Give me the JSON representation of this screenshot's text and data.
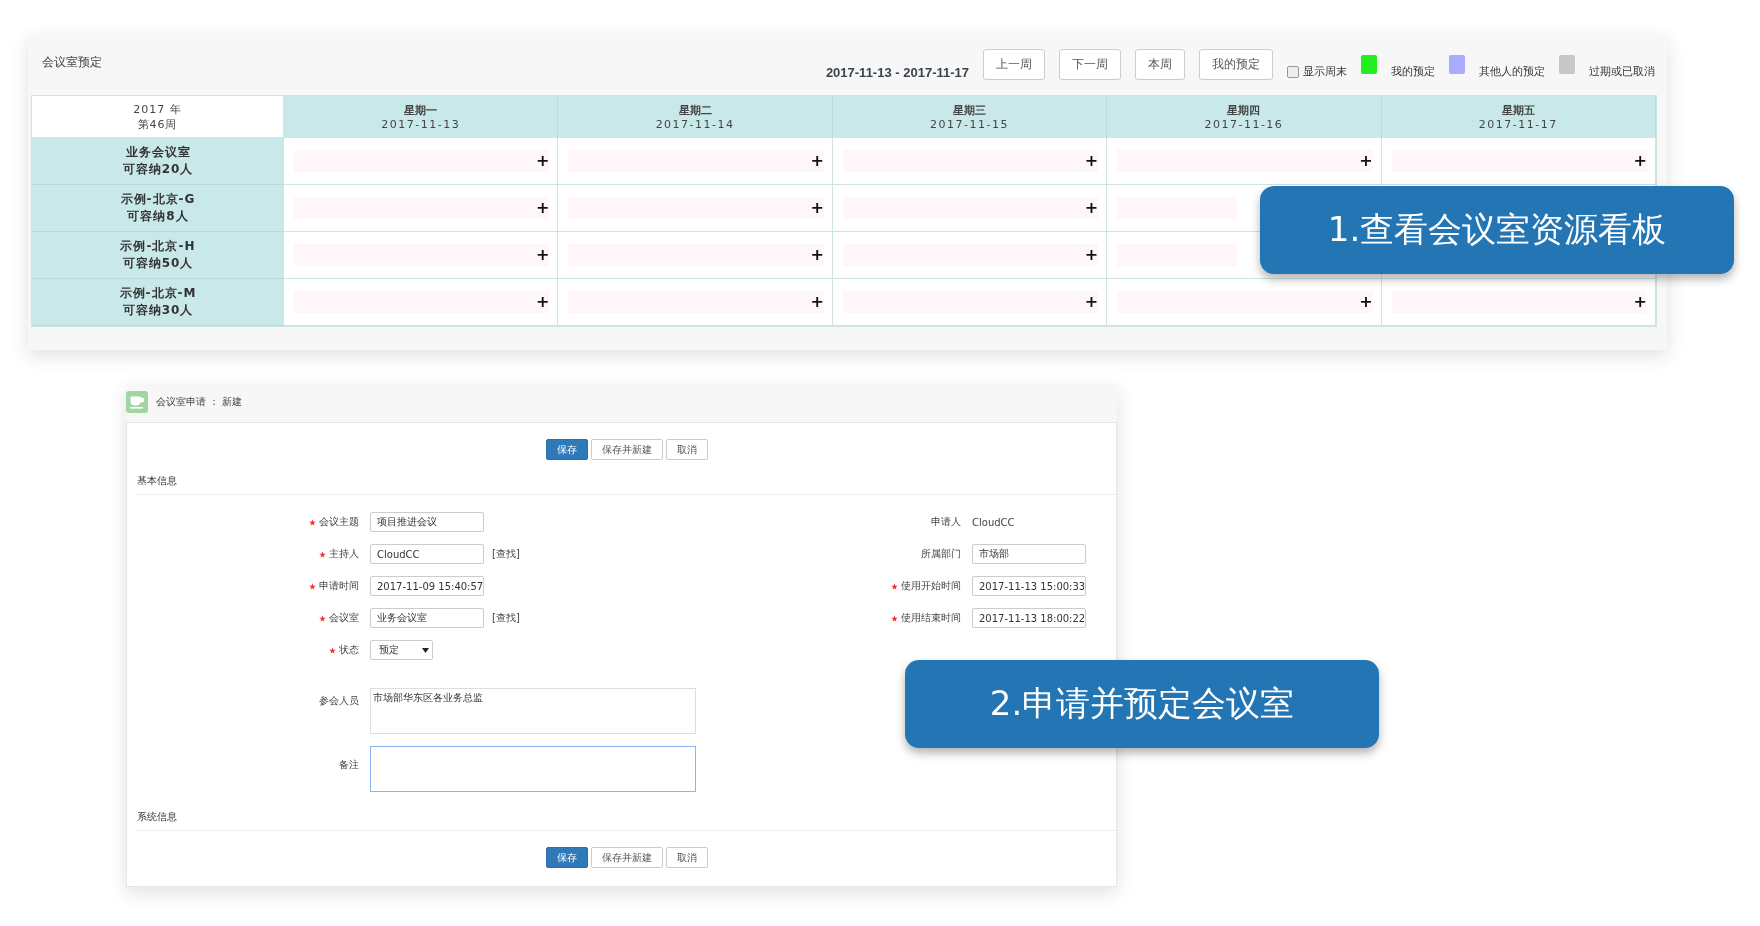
{
  "booking_board": {
    "title": "会议室预定",
    "date_range": "2017-11-13 - 2017-11-17",
    "nav_buttons": [
      "上一周",
      "下一周",
      "本周",
      "我的预定"
    ],
    "show_weekend": {
      "label": "显示周末",
      "checked": false
    },
    "legend": [
      {
        "label": "我的预定",
        "color": "#22ee22"
      },
      {
        "label": "其他人的预定",
        "color": "#aaaaff"
      },
      {
        "label": "过期或已取消",
        "color": "#c8c8c8"
      }
    ],
    "corner": {
      "year": "2017 年",
      "week": "第46周"
    },
    "days": [
      {
        "name": "星期一",
        "date": "2017-11-13"
      },
      {
        "name": "星期二",
        "date": "2017-11-14"
      },
      {
        "name": "星期三",
        "date": "2017-11-15"
      },
      {
        "name": "星期四",
        "date": "2017-11-16"
      },
      {
        "name": "星期五",
        "date": "2017-11-17"
      }
    ],
    "rooms": [
      {
        "name": "业务会议室",
        "capacity": "可容纳20人",
        "cells": [
          "+",
          "+",
          "+",
          "+",
          "+"
        ]
      },
      {
        "name": "示例-北京-G",
        "capacity": "可容纳8人",
        "cells": [
          "+",
          "+",
          "+"
        ]
      },
      {
        "name": "示例-北京-H",
        "capacity": "可容纳50人",
        "cells": [
          "+",
          "+",
          "+"
        ]
      },
      {
        "name": "示例-北京-M",
        "capacity": "可容纳30人",
        "cells": [
          "+",
          "+",
          "+",
          "+",
          "+"
        ]
      }
    ],
    "callout": "1.查看会议室资源看板"
  },
  "form": {
    "title": "会议室申请 ： 新建",
    "top_buttons": [
      {
        "label": "保存",
        "kind": "primary"
      },
      {
        "label": "保存并新建",
        "kind": "default"
      },
      {
        "label": "取消",
        "kind": "default"
      }
    ],
    "basic_section": "基本信息",
    "left_fields": [
      {
        "label": "会议主题",
        "required": true,
        "kind": "input",
        "value": "项目推进会议"
      },
      {
        "label": "主持人",
        "required": true,
        "kind": "lookup",
        "value": "CloudCC",
        "link": "[查找]"
      },
      {
        "label": "申请时间",
        "required": true,
        "kind": "input",
        "value": "2017-11-09 15:40:57"
      },
      {
        "label": "会议室",
        "required": true,
        "kind": "lookup",
        "value": "业务会议室",
        "link": "[查找]"
      },
      {
        "label": "状态",
        "required": true,
        "kind": "select",
        "value": "预定"
      },
      {
        "label": "参会人员",
        "required": false,
        "kind": "textarea",
        "value": "市场部华东区各业务总监",
        "focused": false
      },
      {
        "label": "备注",
        "required": false,
        "kind": "textarea",
        "focused": true
      }
    ],
    "right_fields": [
      {
        "label": "申请人",
        "required": false,
        "kind": "text",
        "value": "CloudCC"
      },
      {
        "label": "所属部门",
        "required": false,
        "kind": "input",
        "value": "市场部"
      },
      {
        "label": "使用开始时间",
        "required": true,
        "kind": "input",
        "value": "2017-11-13 15:00:33"
      },
      {
        "label": "使用结束时间",
        "required": true,
        "kind": "input",
        "value": "2017-11-13 18:00:22"
      }
    ],
    "system_section": "系统信息",
    "bottom_buttons": [
      {
        "label": "保存",
        "kind": "primary"
      },
      {
        "label": "保存并新建",
        "kind": "default"
      },
      {
        "label": "取消",
        "kind": "default"
      }
    ],
    "callout": "2.申请并预定会议室"
  }
}
